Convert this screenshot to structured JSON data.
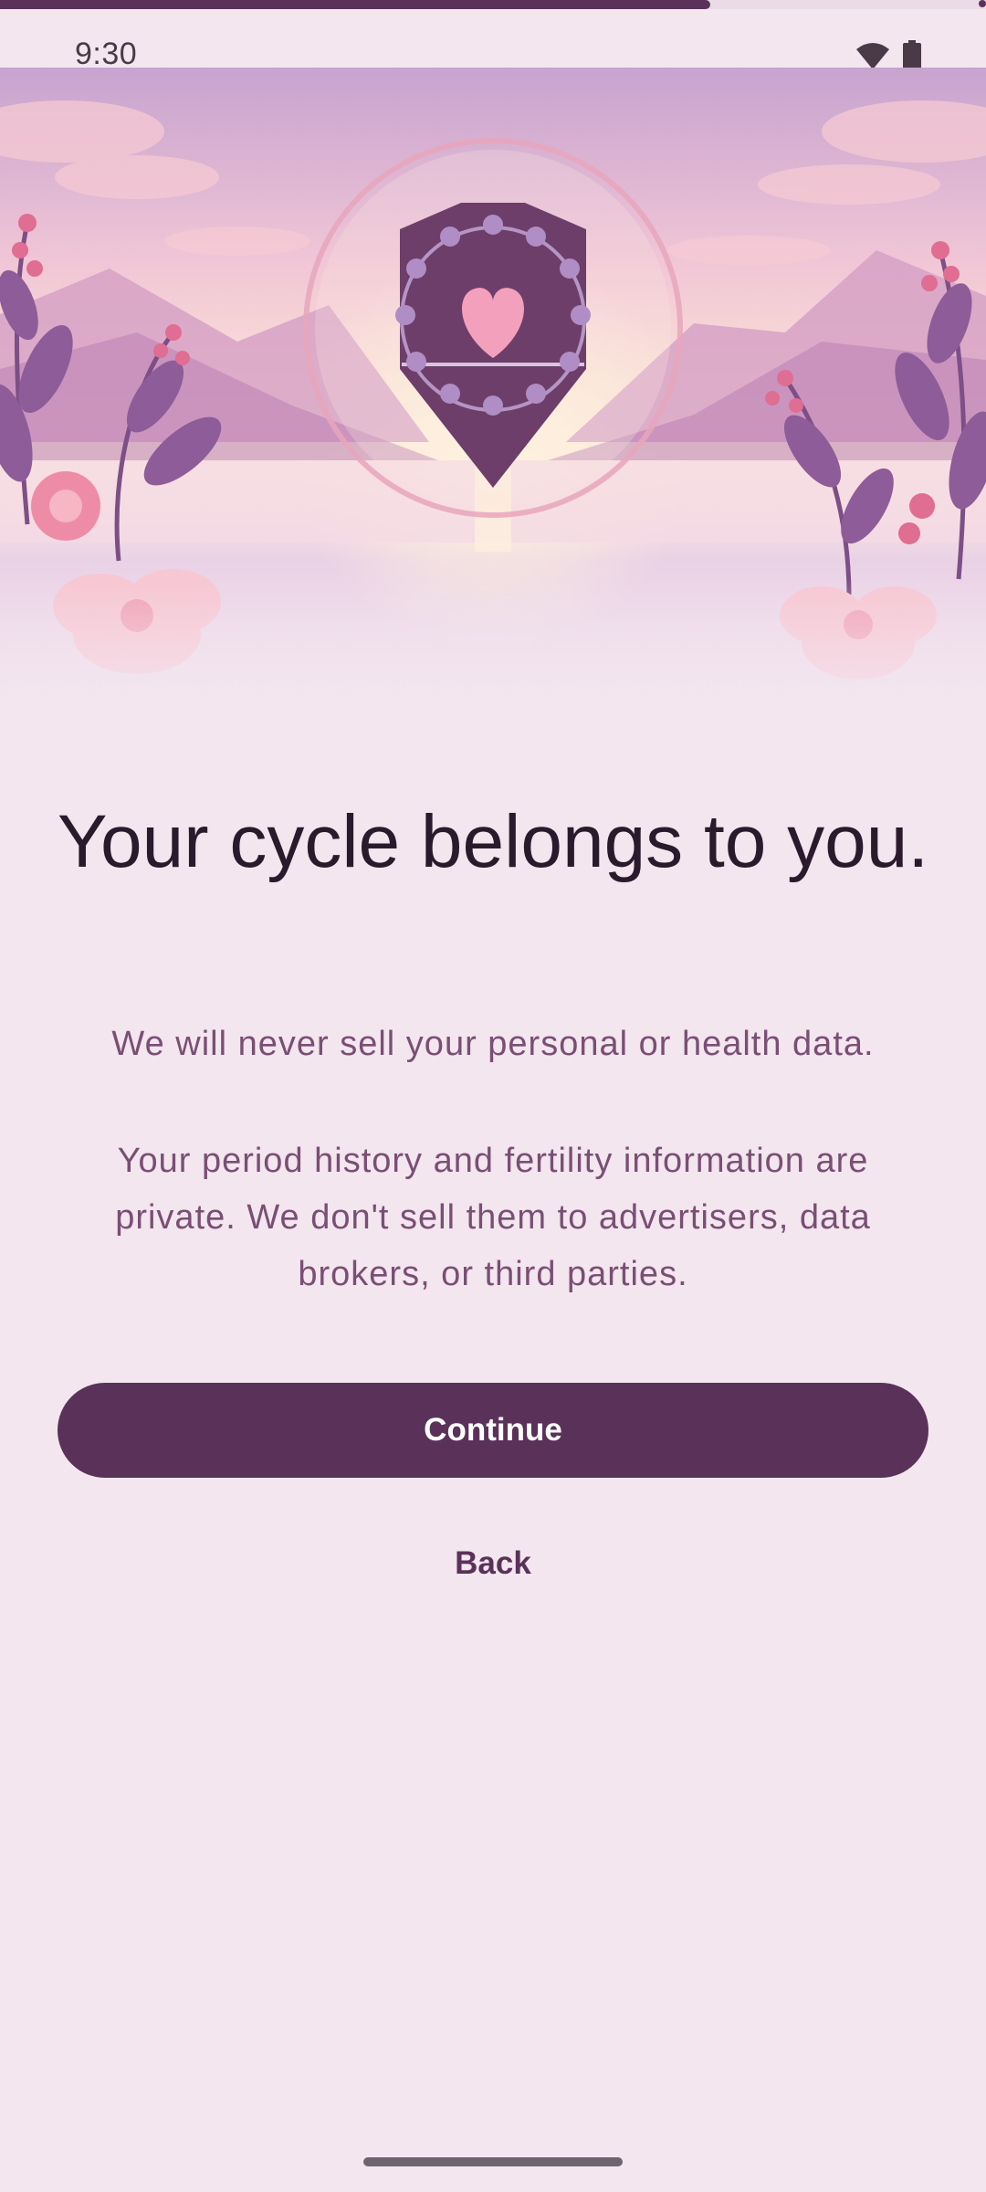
{
  "progress": {
    "fraction": 0.72
  },
  "status_bar": {
    "time": "9:30",
    "icons": [
      "wifi-icon",
      "battery-icon"
    ]
  },
  "hero": {
    "illustration": "shield-with-heart-over-lake-and-flowers",
    "icon": "shield-heart-icon"
  },
  "content": {
    "title": "Your cycle belongs to you.",
    "subtitle": "We will never sell your personal or health data.",
    "body": "Your period history and fertility information are private. We don't sell them to advertisers, data brokers, or third parties."
  },
  "actions": {
    "continue_label": "Continue",
    "back_label": "Back"
  },
  "colors": {
    "primary": "#5a3259",
    "background": "#f3e6ef",
    "title_text": "#2b1a2c",
    "body_text": "#7a4f74",
    "accent_pink": "#f3a0bd"
  }
}
